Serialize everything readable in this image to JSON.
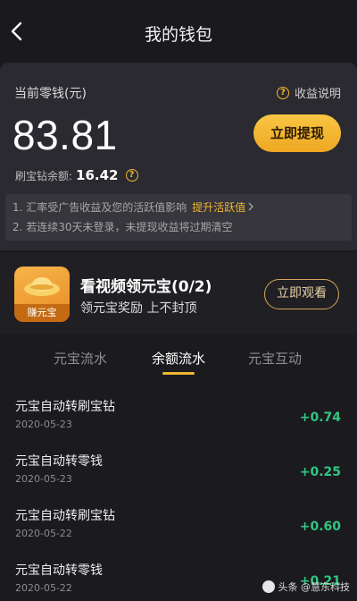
{
  "header": {
    "title": "我的钱包"
  },
  "wallet": {
    "balance_label": "当前零钱(元)",
    "help_label": "收益说明",
    "balance": "83.81",
    "withdraw_label": "立即提现",
    "diamond_label": "刷宝钻余额:",
    "diamond_value": "16.42",
    "notes": {
      "line1": "1. 汇率受广告收益及您的活跃值影响",
      "line1_link": "提升活跃值",
      "line2": "2. 若连续30天未登录，未提现收益将过期清空"
    }
  },
  "promo": {
    "icon_label": "赚元宝",
    "title": "看视频领元宝(0/2)",
    "subtitle": "领元宝奖励 上不封顶",
    "button_label": "立即观看"
  },
  "tabs": [
    {
      "label": "元宝流水",
      "active": false
    },
    {
      "label": "余额流水",
      "active": true
    },
    {
      "label": "元宝互动",
      "active": false
    }
  ],
  "records": [
    {
      "title": "元宝自动转刷宝钻",
      "date": "2020-05-23",
      "amount": "+0.74"
    },
    {
      "title": "元宝自动转零钱",
      "date": "2020-05-23",
      "amount": "+0.25"
    },
    {
      "title": "元宝自动转刷宝钻",
      "date": "2020-05-22",
      "amount": "+0.60"
    },
    {
      "title": "元宝自动转零钱",
      "date": "2020-05-22",
      "amount": "+0.21"
    }
  ],
  "watermark": {
    "text": "头条 @慧东科技"
  },
  "colors": {
    "accent": "#f3b531",
    "positive": "#31c680",
    "background": "#1b1b1f",
    "card": "#2a2a30"
  }
}
